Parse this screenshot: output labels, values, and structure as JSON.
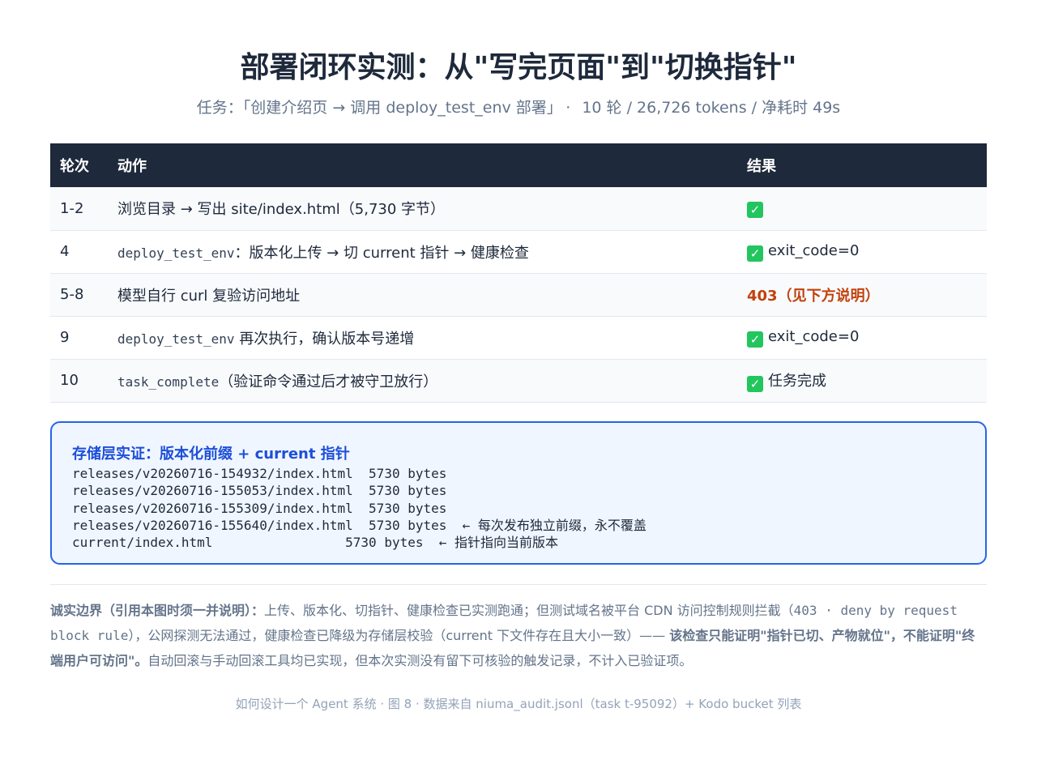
{
  "header": {
    "title": "部署闭环实测：从\"写完页面\"到\"切换指针\"",
    "subtitle_task": "任务：「创建介绍页 → 调用 deploy_test_env 部署」",
    "subtitle_sep": "·",
    "subtitle_stats": "10 轮 / 26,726 tokens / 净耗时 49s"
  },
  "table": {
    "headers": [
      "轮次",
      "动作",
      "结果"
    ],
    "rows": [
      {
        "round": "1-2",
        "action_code": "",
        "action": "浏览目录 → 写出 site/index.html（5,730 字节）",
        "result_icon": "check-icon",
        "result": ""
      },
      {
        "round": "4",
        "action_code": "deploy_test_env",
        "action": "：版本化上传 → 切 current 指针 → 健康检查",
        "result_icon": "check-icon",
        "result": "exit_code=0"
      },
      {
        "round": "5-8",
        "action_code": "",
        "action": "模型自行 curl 复验访问地址",
        "result_icon": "",
        "result": "403（见下方说明）"
      },
      {
        "round": "9",
        "action_code": "deploy_test_env",
        "action": " 再次执行，确认版本号递增",
        "result_icon": "check-icon",
        "result": "exit_code=0"
      },
      {
        "round": "10",
        "action_code": "task_complete",
        "action": "（验证命令通过后才被守卫放行）",
        "result_icon": "check-icon",
        "result": "任务完成"
      }
    ]
  },
  "storage": {
    "title": "存储层实证：版本化前缀 + current 指针",
    "lines": [
      "releases/v20260716-154932/index.html  5730 bytes",
      "releases/v20260716-155053/index.html  5730 bytes",
      "releases/v20260716-155309/index.html  5730 bytes",
      "releases/v20260716-155640/index.html  5730 bytes  ← 每次发布独立前缀，永不覆盖",
      "current/index.html                 5730 bytes  ← 指针指向当前版本"
    ]
  },
  "honesty": {
    "label": "诚实边界（引用本图时须一并说明）：",
    "text1": "上传、版本化、切指针、健康检查已实测跑通；但测试域名被平台 CDN 访问控制规则拦截（",
    "code": "403 · deny by request block rule",
    "text2": "），公网探测无法通过，健康检查已降级为存储层校验（current 下文件存在且大小一致）—— ",
    "bold": "该检查只能证明\"指针已切、产物就位\"，不能证明\"终端用户可访问\"。",
    "text3": "自动回滚与手动回滚工具均已实现，但本次实测没有留下可核验的触发记录，不计入已验证项。"
  },
  "footer": "如何设计一个 Agent 系统 · 图 8 · 数据来自 niuma_audit.jsonl（task t-95092）+ Kodo bucket 列表",
  "colors": {
    "header_bg": "#1e293b",
    "accent_blue": "#2563eb",
    "warn_orange": "#c2410c",
    "check_green": "#22c55e"
  }
}
